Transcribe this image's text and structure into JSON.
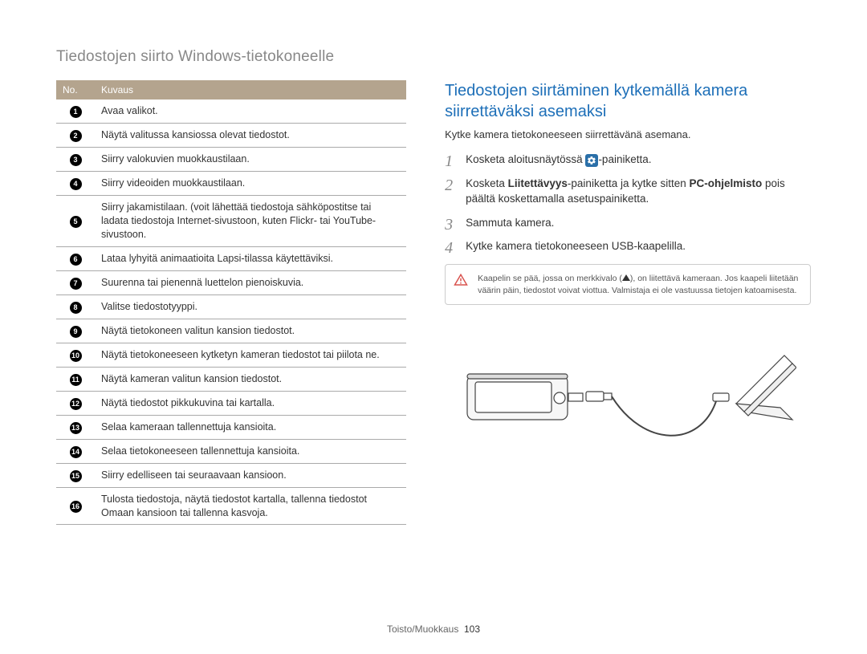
{
  "pageTitle": "Tiedostojen siirto Windows-tietokoneelle",
  "table": {
    "headers": {
      "no": "No.",
      "desc": "Kuvaus"
    },
    "rows": [
      "Avaa valikot.",
      "Näytä valitussa kansiossa olevat tiedostot.",
      "Siirry valokuvien muokkaustilaan.",
      "Siirry videoiden muokkaustilaan.",
      "Siirry jakamistilaan. (voit lähettää tiedostoja sähköpostitse tai ladata tiedostoja Internet-sivustoon, kuten Flickr- tai YouTube-sivustoon.",
      "Lataa lyhyitä animaatioita Lapsi-tilassa käytettäviksi.",
      "Suurenna tai pienennä luettelon pienoiskuvia.",
      "Valitse tiedostotyyppi.",
      "Näytä tietokoneen valitun kansion tiedostot.",
      "Näytä tietokoneeseen kytketyn kameran tiedostot tai piilota ne.",
      "Näytä kameran valitun kansion tiedostot.",
      "Näytä tiedostot pikkukuvina tai kartalla.",
      "Selaa kameraan tallennettuja kansioita.",
      "Selaa tietokoneeseen tallennettuja kansioita.",
      "Siirry edelliseen tai seuraavaan kansioon.",
      "Tulosta tiedostoja, näytä tiedostot kartalla, tallenna tiedostot Omaan kansioon tai tallenna kasvoja."
    ]
  },
  "right": {
    "heading": "Tiedostojen siirtäminen kytkemällä kamera siirrettäväksi asemaksi",
    "intro": "Kytke kamera tietokoneeseen siirrettävänä asemana.",
    "steps": {
      "s1a": "Kosketa aloitusnäytössä ",
      "s1b": "-painiketta.",
      "s2a": "Kosketa ",
      "s2bold1": "Liitettävyys",
      "s2b": "-painiketta ja kytke sitten ",
      "s2bold2": "PC-ohjelmisto",
      "s2c": " pois päältä koskettamalla asetuspainiketta.",
      "s3": "Sammuta kamera.",
      "s4": "Kytke kamera tietokoneeseen USB-kaapelilla."
    },
    "note": {
      "text_a": "Kaapelin se pää, jossa on merkkivalo (",
      "text_b": "), on liitettävä kameraan. Jos kaapeli liitetään väärin päin, tiedostot voivat viottua. Valmistaja ei ole vastuussa tietojen katoamisesta."
    }
  },
  "footer": {
    "section": "Toisto/Muokkaus",
    "page": "103"
  }
}
